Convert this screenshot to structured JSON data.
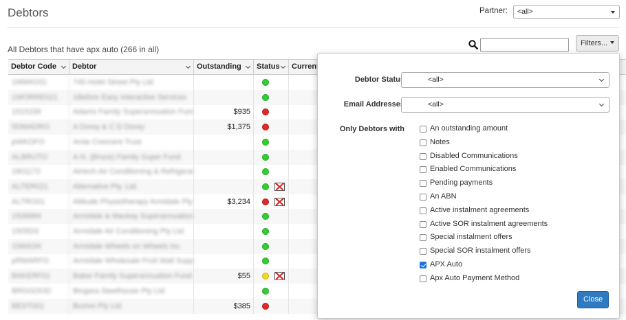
{
  "header": {
    "title": "Debtors",
    "partner_label": "Partner:",
    "partner_value": "<all>"
  },
  "summary": "All Debtors that have apx auto (266 in all)",
  "toolbar": {
    "filters_label": "Filters..."
  },
  "columns": [
    "Debtor Code",
    "Debtor",
    "Outstanding",
    "Status",
    "Current"
  ],
  "rows": [
    {
      "code": "1MWK031",
      "name": "745 Hotel Street Pty Ltd",
      "outstanding": "",
      "status": "green",
      "mail": false
    },
    {
      "code": "1WORRE021",
      "name": "1Before Easy Interactive Services",
      "outstanding": "",
      "status": "green",
      "mail": false
    },
    {
      "code": "1515336",
      "name": "Adams Family Superannuation Fund",
      "outstanding": "$935",
      "status": "red",
      "mail": false
    },
    {
      "code": "5DMADRO",
      "name": "A Dorey & C D Dorey",
      "outstanding": "$1,375",
      "status": "red",
      "mail": false
    },
    {
      "code": "pWKOFO",
      "name": "Amie Crescent Trust",
      "outstanding": "",
      "status": "green",
      "mail": false
    },
    {
      "code": "ALBRUTO",
      "name": "A.N. (Bruce) Family Super Fund",
      "outstanding": "",
      "status": "green",
      "mail": false
    },
    {
      "code": "1801172",
      "name": "Airtech Air Conditioning & Refrigeration",
      "outstanding": "",
      "status": "green",
      "mail": false
    },
    {
      "code": "ALTER021",
      "name": "Alternative Pty. Ltd.",
      "outstanding": "",
      "status": "green",
      "mail": true
    },
    {
      "code": "ALTRO01",
      "name": "Altitude Physiotherapy Armidale Pty",
      "outstanding": "$3,234",
      "status": "red",
      "mail": true
    },
    {
      "code": "1508884",
      "name": "Armidale & Mackay Superannuation",
      "outstanding": "",
      "status": "green",
      "mail": false
    },
    {
      "code": "1505DS",
      "name": "Armidale Air Conditioning Pty Ltd",
      "outstanding": "",
      "status": "green",
      "mail": false
    },
    {
      "code": "1560034",
      "name": "Armidale Wheels on Wheels Inc",
      "outstanding": "",
      "status": "green",
      "mail": false
    },
    {
      "code": "pRMARFO",
      "name": "Armidale Wholesale Fruit Wall Supply",
      "outstanding": "",
      "status": "green",
      "mail": false
    },
    {
      "code": "BAKERF01",
      "name": "Baker Family Superannuation Fund",
      "outstanding": "$55",
      "status": "yellow",
      "mail": true
    },
    {
      "code": "BRGGOOD",
      "name": "Bingara Steelhouse Pty Ltd",
      "outstanding": "",
      "status": "green",
      "mail": false
    },
    {
      "code": "BEST001",
      "name": "Bozivo Pty Ltd",
      "outstanding": "$385",
      "status": "red",
      "mail": false
    }
  ],
  "filters": {
    "debtor_status_label": "Debtor Status",
    "debtor_status_value": "<all>",
    "email_label": "Email Addresses",
    "email_value": "<all>",
    "only_label": "Only Debtors with",
    "options": [
      {
        "label": "An outstanding amount",
        "checked": false
      },
      {
        "label": "Notes",
        "checked": false
      },
      {
        "label": "Disabled Communications",
        "checked": false
      },
      {
        "label": "Enabled Communications",
        "checked": false
      },
      {
        "label": "Pending payments",
        "checked": false
      },
      {
        "label": "An ABN",
        "checked": false
      },
      {
        "label": "Active instalment agreements",
        "checked": false
      },
      {
        "label": "Active SOR instalment agreements",
        "checked": false
      },
      {
        "label": "Special instalment offers",
        "checked": false
      },
      {
        "label": "Special SOR instalment offers",
        "checked": false
      },
      {
        "label": "APX Auto",
        "checked": true
      },
      {
        "label": "Apx Auto Payment Method",
        "checked": false
      }
    ],
    "close_label": "Close"
  },
  "colors": {
    "green": "#2fd02f",
    "red": "#e02a2a",
    "yellow": "#f2da1c",
    "primary": "#2f7bc2"
  }
}
